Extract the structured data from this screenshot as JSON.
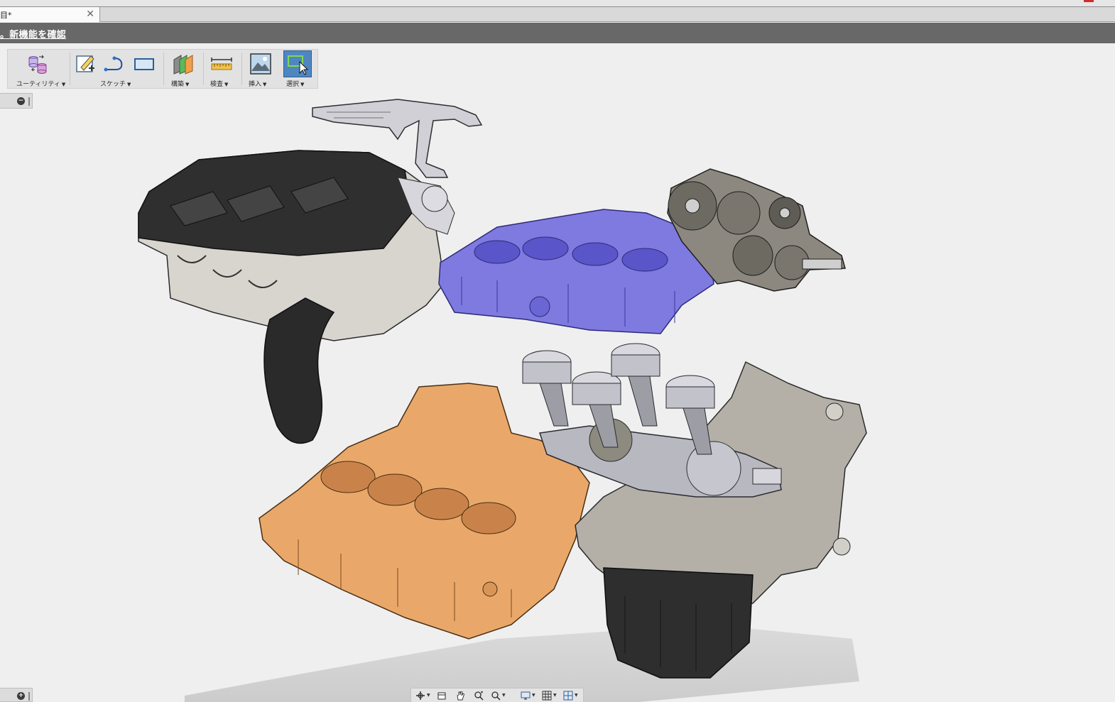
{
  "window": {
    "red_mark_color": "#d12c2c"
  },
  "tab": {
    "label": "目*",
    "close_glyph": "✕"
  },
  "banner": {
    "text": "。新機能を確認"
  },
  "toolbar": {
    "groups": [
      {
        "label": "ユーティリティ",
        "icon": "utility-icon"
      },
      {
        "label": "スケッチ",
        "icon": "sketch-icon"
      },
      {
        "label": "構築",
        "icon": "construct-icon"
      },
      {
        "label": "検査",
        "icon": "inspect-icon"
      },
      {
        "label": "挿入",
        "icon": "insert-icon"
      },
      {
        "label": "選択",
        "icon": "select-icon",
        "active": true
      }
    ],
    "dropdown_caret": "▼"
  },
  "browser": {
    "collapse_glyph": "−",
    "expand_glyph": "+"
  },
  "viewport": {
    "parts": [
      {
        "name": "cylinder-head",
        "color": "#2b2b2b"
      },
      {
        "name": "cylinder-block",
        "color": "#7e7ae0"
      },
      {
        "name": "transmission-gears",
        "color": "#6e6a62"
      },
      {
        "name": "upper-crankcase",
        "color": "#e9a86a"
      },
      {
        "name": "crankshaft-pistons",
        "color": "#b8b8c0"
      },
      {
        "name": "lower-crankcase",
        "color": "#a7a49c"
      },
      {
        "name": "intake-duct",
        "color": "#2a2a2a"
      }
    ]
  },
  "navbar": {
    "icons": [
      "orbit-icon",
      "look-at-icon",
      "pan-icon",
      "zoom-icon",
      "zoom-window-icon",
      "display-settings-icon",
      "grid-icon",
      "viewports-icon"
    ]
  }
}
